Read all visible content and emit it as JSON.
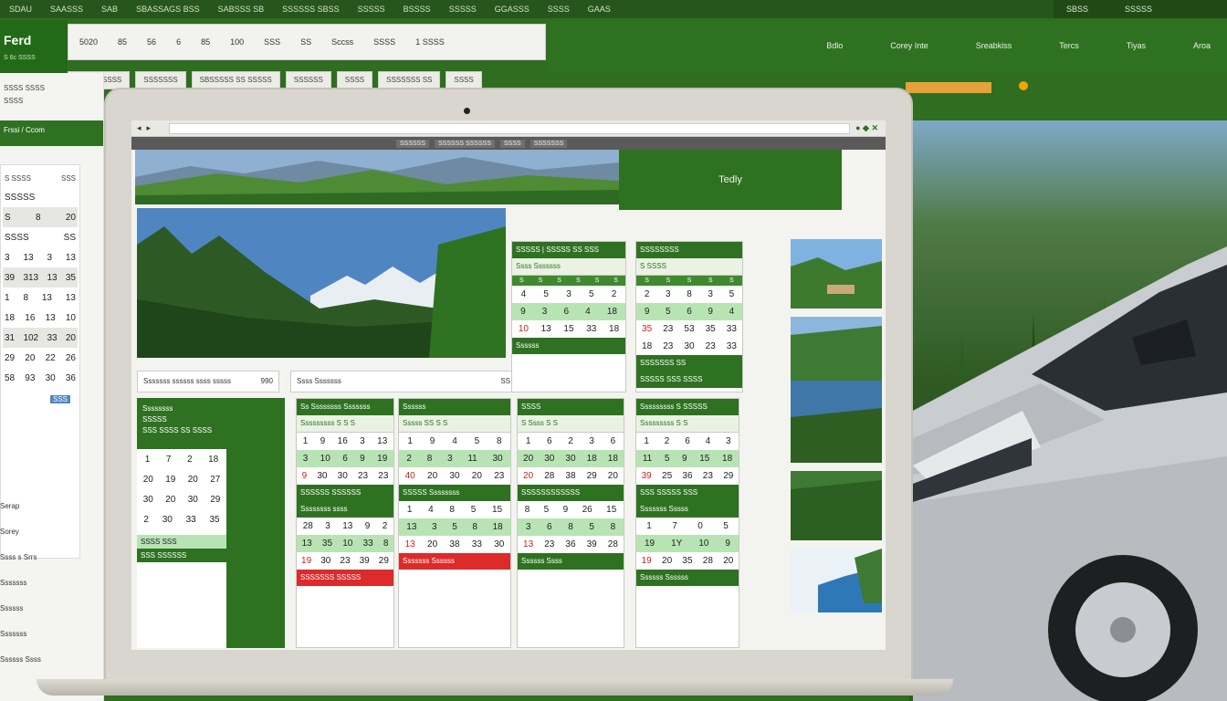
{
  "topbar": {
    "items": [
      "SDAU",
      "SAASSS",
      "SAB",
      "SBASSAGS BSS",
      "SABSSS SB",
      "SSSSSS SBSS",
      "SSSSS",
      "BSSSS",
      "SSSSS",
      "GGASSS",
      "SSSS",
      "GAAS"
    ],
    "right": [
      "SBSS",
      "SSSSS"
    ]
  },
  "rightnav": [
    "Bdlo",
    "Corey Inte",
    "Sreabkiss",
    "Tercs",
    "Tiyas",
    "Aroa"
  ],
  "brand": {
    "title": "Ferd",
    "subtitle": "S 6c SSSS"
  },
  "search": {
    "items": [
      "5020",
      "85",
      "56",
      "6",
      "85",
      "100",
      "SSS",
      "SS",
      "Sccss",
      "SSSS",
      "1 SSSS"
    ]
  },
  "subbar": [
    "SSSS SSSSS",
    "SSSSSSS",
    "SBSSSSS SS SSSSS",
    "SSSSSS",
    "SSSS",
    "SSSSSSS SS",
    "SSSS"
  ],
  "sidebar": {
    "top_lines": [
      "SSSS SSSS",
      "SSSS"
    ],
    "head": "Frssi / Ccom",
    "mini_header": [
      "S SSSS",
      "SSS"
    ],
    "mini_rows": [
      [
        "SSSSS",
        ""
      ],
      [
        "S",
        "8",
        "20"
      ],
      [
        "SSSS",
        "SS"
      ],
      [
        "3",
        "13",
        "3",
        "13"
      ],
      [
        "39",
        "313",
        "13",
        "35"
      ],
      [
        "1",
        "8",
        "13",
        "13"
      ],
      [
        "18",
        "16",
        "13",
        "10"
      ],
      [
        "31",
        "102",
        "33",
        "20"
      ],
      [
        "29",
        "20",
        "22",
        "26"
      ],
      [
        "58",
        "93",
        "30",
        "36"
      ]
    ],
    "mini_badge": "SSS",
    "links": [
      "Serap",
      "Sorey",
      "Ssss s Srrs",
      "Sssssss",
      "Ssssss",
      "Sssssss",
      "Ssssss Ssss"
    ]
  },
  "screen": {
    "nav": [
      "SSSSSS",
      "SSSSSS SSSSSS",
      "SSSS",
      "SSSSSSS"
    ],
    "hero_side": "Tedly",
    "field1": "Sssssss ssssss ssss sssss",
    "field1_num": "990",
    "field2": "Ssss Sssssss",
    "field2_num": "SS"
  },
  "calendars": {
    "big": {
      "head1": "Ssssssss",
      "head2": "SSSSS",
      "head3": "SSS SSSS SS SSSS",
      "rows": [
        [
          "1",
          "7",
          "2",
          "18"
        ],
        [
          "20",
          "19",
          "20",
          "27"
        ],
        [
          "30",
          "20",
          "30",
          "29"
        ],
        [
          "2",
          "30",
          "33",
          "35"
        ]
      ],
      "foot1": "SSSS SSS",
      "foot2": "SSS SSSSSS"
    },
    "c1": {
      "title": "SSSSS | SSSSS SS SSS",
      "sub": "Ssss Sssssss",
      "wd": [
        "S",
        "S",
        "S",
        "S",
        "S",
        "S"
      ],
      "rows": [
        [
          "4",
          "5",
          "3",
          "5",
          "2"
        ],
        [
          "9",
          "3",
          "6",
          "4",
          "18"
        ],
        [
          "10",
          "13",
          "15",
          "33",
          "18"
        ]
      ],
      "foot": "Ssssss"
    },
    "c2": {
      "title": "SSSSSSSS",
      "sub": "S SSSS",
      "wd": [
        "S",
        "S",
        "S",
        "S",
        "S"
      ],
      "rows": [
        [
          "2",
          "3",
          "8",
          "3",
          "5"
        ],
        [
          "9",
          "5",
          "6",
          "9",
          "4"
        ],
        [
          "35",
          "23",
          "53",
          "35",
          "33"
        ],
        [
          "18",
          "23",
          "30",
          "23",
          "33"
        ]
      ],
      "foot": "SSSSSSS SS",
      "foot2": "SSSSS SSS SSSS"
    },
    "c3": {
      "title": "Ss Ssssssss Sssssss",
      "sub": "Sssssssss S S S",
      "rows": [
        [
          "1",
          "9",
          "16",
          "3",
          "13"
        ],
        [
          "3",
          "10",
          "6",
          "9",
          "19"
        ],
        [
          "9",
          "30",
          "30",
          "23",
          "23"
        ]
      ],
      "mid": "SSSSSS SSSSSS",
      "mid2": "Ssssssss ssss",
      "rows2": [
        [
          "28",
          "3",
          "13",
          "9",
          "2"
        ],
        [
          "13",
          "35",
          "10",
          "33",
          "8"
        ],
        [
          "19",
          "30",
          "23",
          "39",
          "29"
        ]
      ],
      "red": "SSSSSSS SSSSS"
    },
    "c4": {
      "title": "Ssssss",
      "sub": "Sssss SS S S",
      "rows": [
        [
          "1",
          "9",
          "4",
          "5",
          "8"
        ],
        [
          "2",
          "8",
          "3",
          "11",
          "30"
        ],
        [
          "40",
          "20",
          "30",
          "20",
          "23"
        ]
      ],
      "mid": "SSSSS Ssssssss",
      "rows2": [
        [
          "1",
          "4",
          "8",
          "5",
          "15"
        ],
        [
          "13",
          "3",
          "5",
          "8",
          "18"
        ],
        [
          "13",
          "20",
          "38",
          "33",
          "30"
        ]
      ],
      "red": "Sssssss Ssssss"
    },
    "c5": {
      "title": "SSSS",
      "sub": "S Ssss S S",
      "rows": [
        [
          "1",
          "6",
          "2",
          "3",
          "6"
        ],
        [
          "20",
          "30",
          "30",
          "18",
          "18"
        ],
        [
          "20",
          "28",
          "38",
          "29",
          "20"
        ]
      ],
      "mid": "SSSSSSSSSSSS",
      "rows2": [
        [
          "8",
          "5",
          "9",
          "26",
          "15"
        ],
        [
          "3",
          "6",
          "8",
          "5",
          "8"
        ],
        [
          "13",
          "23",
          "36",
          "39",
          "28"
        ]
      ],
      "foot": "Ssssss Ssss"
    },
    "c6": {
      "title": "Sssssssss S SSSSS",
      "sub": "Sssssssss S S",
      "rows": [
        [
          "1",
          "2",
          "6",
          "4",
          "3"
        ],
        [
          "11",
          "5",
          "9",
          "15",
          "18"
        ],
        [
          "39",
          "25",
          "36",
          "23",
          "29"
        ]
      ],
      "mid": "SSS SSSSS SSS",
      "mid2": "Sssssss Sssss",
      "rows2": [
        [
          "1",
          "7",
          "0",
          "5"
        ],
        [
          "19",
          "1Y",
          "10",
          "9"
        ],
        [
          "19",
          "20",
          "35",
          "28",
          "20"
        ]
      ],
      "foot": "Ssssss Ssssss"
    }
  },
  "colors": {
    "primary_green": "#2e7221",
    "dark_green": "#27561c",
    "accent_red": "#dd2a2a",
    "accent_orange": "#e6a13a",
    "highlight": "#b8e4b4"
  }
}
